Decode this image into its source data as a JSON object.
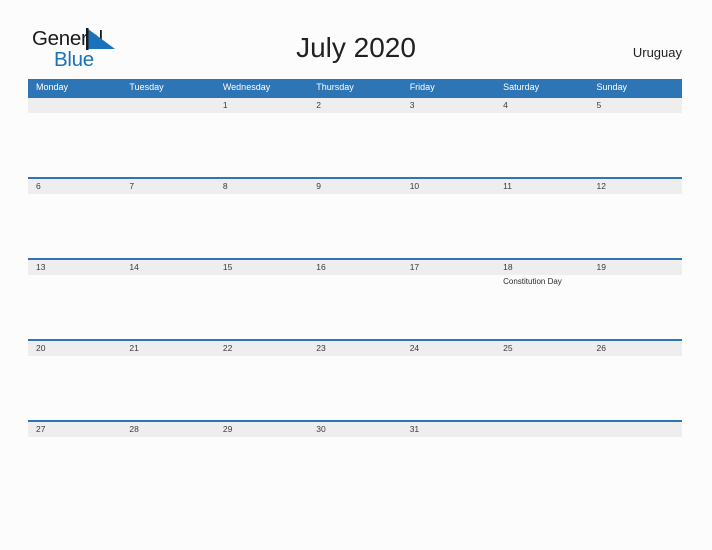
{
  "brand": {
    "name_part1": "General",
    "name_part2": "Blue",
    "flag_icon": "blue-flag-triangle-icon",
    "color_dark": "#1a1a1a",
    "color_blue": "#1b72b8"
  },
  "header": {
    "title": "July 2020",
    "country": "Uruguay"
  },
  "colors": {
    "header_band": "#2e75b6",
    "date_band": "#eeeeee",
    "page_background": "#fcfcfc",
    "date_text": "#3a3a3a",
    "weekday_text": "#ffffff"
  },
  "calendar": {
    "weekdays": [
      "Monday",
      "Tuesday",
      "Wednesday",
      "Thursday",
      "Friday",
      "Saturday",
      "Sunday"
    ],
    "weeks": [
      {
        "days": [
          {
            "number": "",
            "event": ""
          },
          {
            "number": "",
            "event": ""
          },
          {
            "number": "1",
            "event": ""
          },
          {
            "number": "2",
            "event": ""
          },
          {
            "number": "3",
            "event": ""
          },
          {
            "number": "4",
            "event": ""
          },
          {
            "number": "5",
            "event": ""
          }
        ]
      },
      {
        "days": [
          {
            "number": "6",
            "event": ""
          },
          {
            "number": "7",
            "event": ""
          },
          {
            "number": "8",
            "event": ""
          },
          {
            "number": "9",
            "event": ""
          },
          {
            "number": "10",
            "event": ""
          },
          {
            "number": "11",
            "event": ""
          },
          {
            "number": "12",
            "event": ""
          }
        ]
      },
      {
        "days": [
          {
            "number": "13",
            "event": ""
          },
          {
            "number": "14",
            "event": ""
          },
          {
            "number": "15",
            "event": ""
          },
          {
            "number": "16",
            "event": ""
          },
          {
            "number": "17",
            "event": ""
          },
          {
            "number": "18",
            "event": "Constitution Day"
          },
          {
            "number": "19",
            "event": ""
          }
        ]
      },
      {
        "days": [
          {
            "number": "20",
            "event": ""
          },
          {
            "number": "21",
            "event": ""
          },
          {
            "number": "22",
            "event": ""
          },
          {
            "number": "23",
            "event": ""
          },
          {
            "number": "24",
            "event": ""
          },
          {
            "number": "25",
            "event": ""
          },
          {
            "number": "26",
            "event": ""
          }
        ]
      },
      {
        "days": [
          {
            "number": "27",
            "event": ""
          },
          {
            "number": "28",
            "event": ""
          },
          {
            "number": "29",
            "event": ""
          },
          {
            "number": "30",
            "event": ""
          },
          {
            "number": "31",
            "event": ""
          },
          {
            "number": "",
            "event": ""
          },
          {
            "number": "",
            "event": ""
          }
        ]
      }
    ]
  }
}
